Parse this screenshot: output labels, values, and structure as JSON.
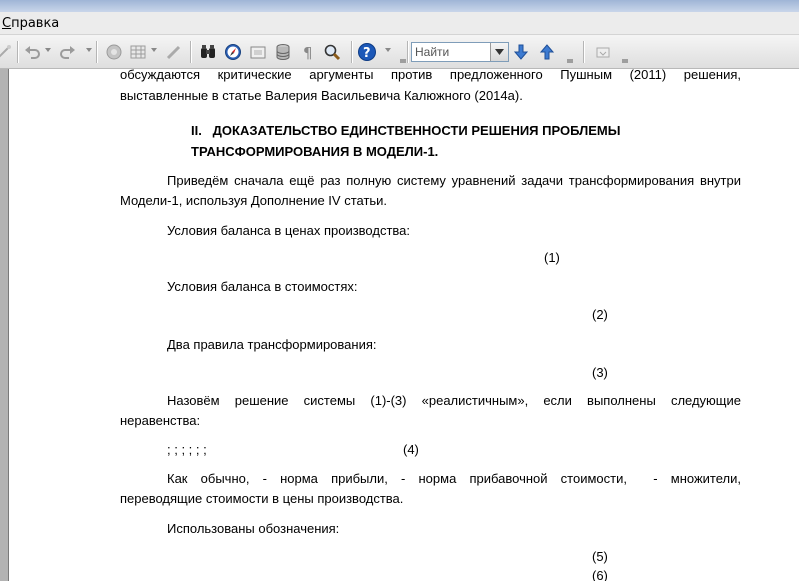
{
  "menu": {
    "help_label": "Справка"
  },
  "toolbar": {
    "icons": [
      "wand-icon",
      "undo-icon",
      "redo-icon",
      "navigator-icon",
      "table-icon",
      "pen-icon",
      "binoculars-icon",
      "compass-icon",
      "frame-icon",
      "database-icon",
      "pilcrow-icon",
      "zoom-icon",
      "help-icon",
      "find-previous-icon",
      "find-next-icon",
      "toolbar-options-icon"
    ],
    "find_placeholder": "Найти"
  },
  "document": {
    "line_1": "обсуждаются критические аргументы против предложенного Пушным (2011) решения,",
    "line_2": "выставленные в статье Валерия Васильевича Калюжного (2014а).",
    "heading_line_1": "II.   ДОКАЗАТЕЛЬСТВО ЕДИНСТВЕННОСТИ РЕШЕНИЯ ПРОБЛЕМЫ",
    "heading_line_2": "ТРАНСФОРМИРОВАНИЯ В МОДЕЛИ-1.",
    "para_1_line_1": "Приведём сначала ещё раз полную систему уравнений задачи трансформирования внутри",
    "para_1_line_2": "Модели-1, используя Дополнение IV статьи.",
    "prices_balance": "Условия баланса в ценах производства:",
    "eq_1": "(1)",
    "values_balance": "Условия баланса в стоимостях:",
    "eq_2": "(2)",
    "two_rules": "Два правила трансформирования:",
    "eq_3": "(3)",
    "realistic_line_1": "Назовём решение системы (1)-(3) «реалистичным», если выполнены следующие",
    "realistic_line_2": "неравенства:",
    "semicolons": "; ; ; ; ; ;",
    "eq_4": "(4)",
    "usual_line_1": "Как обычно, - норма прибыли, - норма прибавочной стоимости,  - множители,",
    "usual_line_2": "переводящие стоимости в цены производства.",
    "notation": "Использованы обозначения:",
    "eq_5": "(5)",
    "eq_6": "(6)"
  }
}
